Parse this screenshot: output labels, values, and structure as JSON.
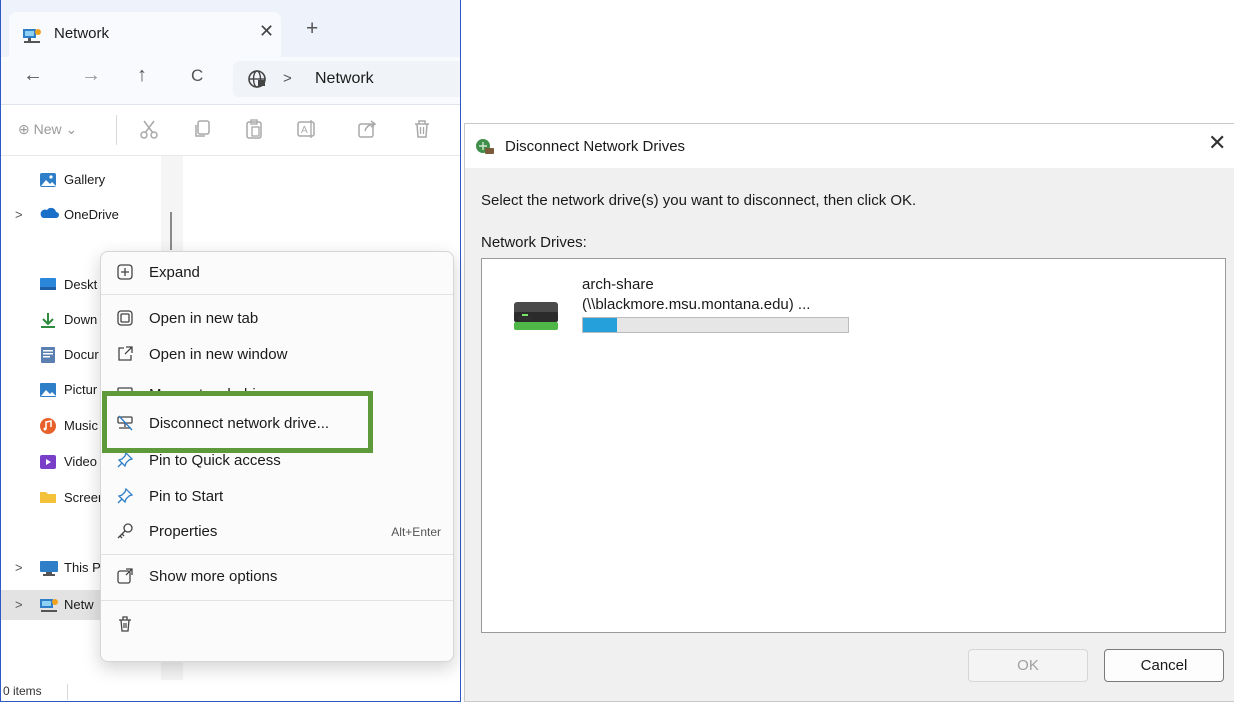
{
  "explorer": {
    "tab_title": "Network",
    "close_glyph": "✕",
    "newtab_glyph": "+",
    "nav": {
      "back": "←",
      "forward": "→",
      "up": "↑",
      "refresh": "C",
      "chevron": ">"
    },
    "address": "Network",
    "toolbar": {
      "new_label": "⊕ New ⌄"
    },
    "sidebar": [
      {
        "label": "Gallery",
        "icon": "gallery-icon"
      },
      {
        "label": "OneDrive",
        "icon": "onedrive-icon",
        "expandable": true
      },
      {
        "label": "Deskt",
        "icon": "desktop-icon"
      },
      {
        "label": "Down",
        "icon": "downloads-icon"
      },
      {
        "label": "Docur",
        "icon": "documents-icon"
      },
      {
        "label": "Pictur",
        "icon": "pictures-icon"
      },
      {
        "label": "Music",
        "icon": "music-icon"
      },
      {
        "label": "Video",
        "icon": "videos-icon"
      },
      {
        "label": "Screer",
        "icon": "folder-icon"
      },
      {
        "label": "This P",
        "icon": "this-pc-icon",
        "expandable": true
      },
      {
        "label": "Netw",
        "icon": "network-icon",
        "expandable": true,
        "selected": true
      }
    ],
    "expand_chevron": ">",
    "status": "0 items"
  },
  "context_menu": {
    "items": [
      {
        "label": "Expand",
        "icon": "expand-icon"
      },
      {
        "label": "Open in new tab",
        "icon": "new-tab-icon"
      },
      {
        "label": "Open in new window",
        "icon": "new-window-icon"
      },
      {
        "label": "Map network drive...",
        "icon": "map-drive-icon"
      },
      {
        "label": "Disconnect network drive...",
        "icon": "disconnect-drive-icon",
        "highlighted": true
      },
      {
        "label": "Pin to Quick access",
        "icon": "pin-icon"
      },
      {
        "label": "Pin to Start",
        "icon": "pin-icon"
      },
      {
        "label": "Properties",
        "icon": "key-icon",
        "shortcut": "Alt+Enter"
      },
      {
        "label": "Show more options",
        "icon": "show-more-icon"
      }
    ],
    "highlight_color": "#5f9a3a"
  },
  "dialog": {
    "title": "Disconnect Network Drives",
    "close_glyph": "✕",
    "instruction": "Select the network drive(s) you want to disconnect, then click OK.",
    "list_label": "Network Drives:",
    "drives": [
      {
        "name": "arch-share",
        "path": "(\\\\blackmore.msu.montana.edu) ...",
        "usage_fraction": 0.13
      }
    ],
    "ok_label": "OK",
    "cancel_label": "Cancel"
  },
  "colors": {
    "window_border": "#2e59c4",
    "progress_fill": "#26a0da",
    "highlight_border": "#5f9a3a"
  }
}
